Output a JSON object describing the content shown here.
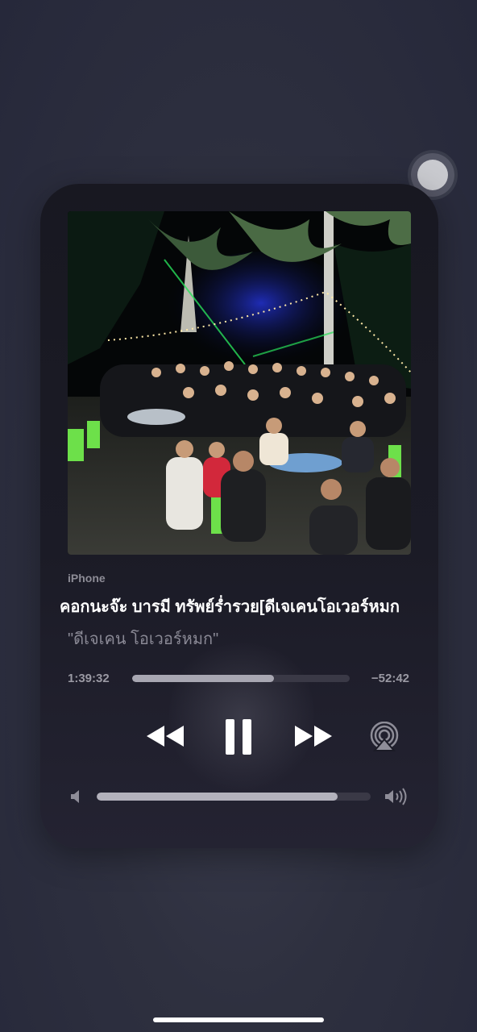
{
  "player": {
    "source": "iPhone",
    "title": "คอกนะจ๊ะ บารมี ทรัพย์ร่ำรวย[ดีเจเคนโอเวอร์หมก",
    "artist": "\"ดีเจเคน โอเวอร์หมก\"",
    "elapsed": "1:39:32",
    "remaining": "−52:42",
    "progress": 0.65,
    "volume": 0.88,
    "artwork": "party-group-photo-night-palm-trees"
  },
  "icons": {
    "rewind": "rewind-icon",
    "pause": "pause-icon",
    "forward": "fast-forward-icon",
    "airplay": "airplay-icon",
    "volume_low": "speaker-low-icon",
    "volume_high": "speaker-high-icon"
  },
  "colors": {
    "card": "#1b1b26",
    "accent_fill": "#a8a7b2",
    "track": "#3a3946"
  }
}
